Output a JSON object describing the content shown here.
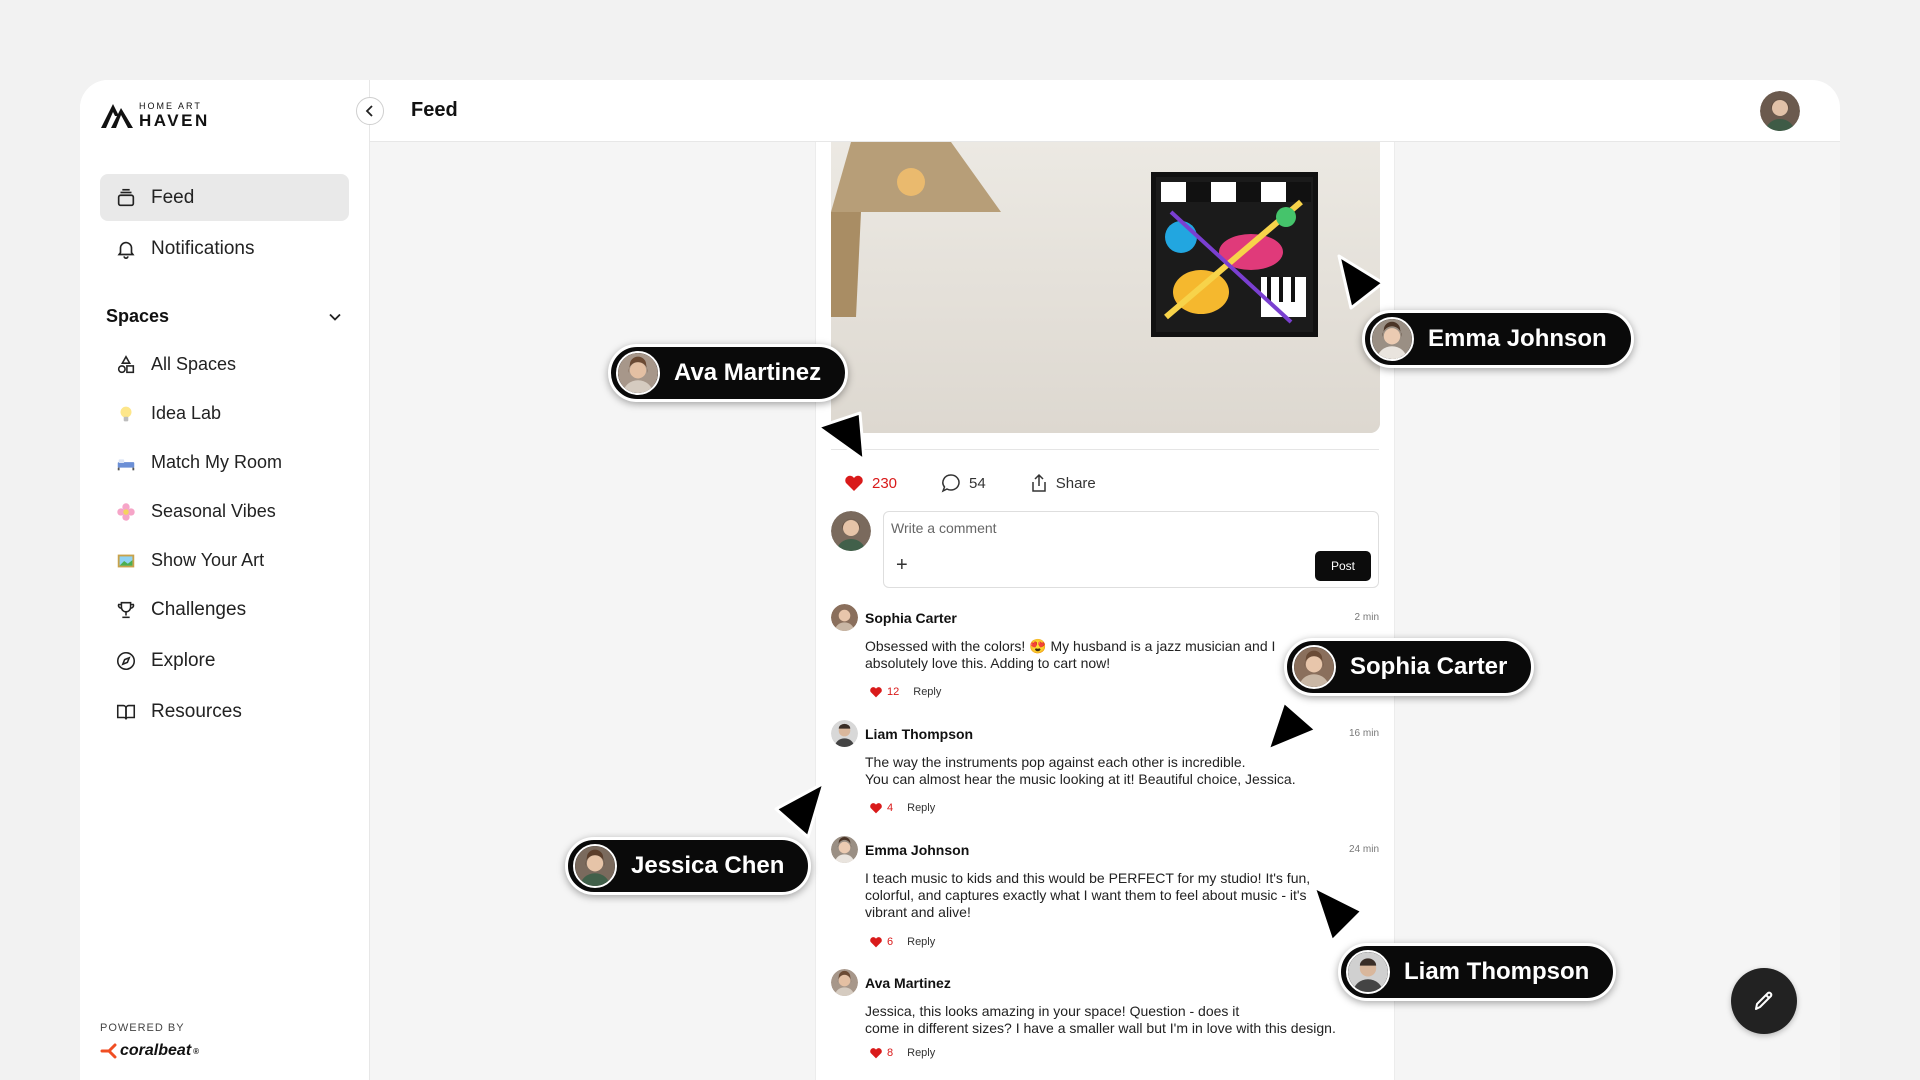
{
  "brand": {
    "small": "HOME ART",
    "big": "HAVEN"
  },
  "header": {
    "title": "Feed"
  },
  "sidebar": {
    "nav": [
      {
        "label": "Feed",
        "icon": "feed-icon"
      },
      {
        "label": "Notifications",
        "icon": "bell-icon"
      }
    ],
    "spaces_title": "Spaces",
    "spaces": [
      {
        "label": "All Spaces",
        "icon": "shapes-icon"
      },
      {
        "label": "Idea Lab",
        "icon": "lightbulb-icon"
      },
      {
        "label": "Match My Room",
        "icon": "bed-icon"
      },
      {
        "label": "Seasonal Vibes",
        "icon": "flower-icon"
      },
      {
        "label": "Show Your Art",
        "icon": "picture-icon"
      }
    ],
    "more": [
      {
        "label": "Challenges",
        "icon": "trophy-icon"
      },
      {
        "label": "Explore",
        "icon": "compass-icon"
      },
      {
        "label": "Resources",
        "icon": "book-icon"
      }
    ],
    "powered_by": "POWERED BY",
    "powered_brand": "coralbeat"
  },
  "post": {
    "likes": "230",
    "comments": "54",
    "share": "Share"
  },
  "composer": {
    "placeholder": "Write a comment",
    "post_label": "Post",
    "plus": "+"
  },
  "comments": [
    {
      "name": "Sophia Carter",
      "time": "2 min",
      "text": "Obsessed with the colors! 😍 My husband is a jazz musician and I\nabsolutely love this. Adding to cart now!",
      "likes": "12",
      "reply": "Reply"
    },
    {
      "name": "Liam Thompson",
      "time": "16 min",
      "text": "The way the instruments pop against each other is incredible.\nYou can almost hear the music looking at it! Beautiful choice, Jessica.",
      "likes": "4",
      "reply": "Reply"
    },
    {
      "name": "Emma Johnson",
      "time": "24 min",
      "text": "I teach music to kids and this would be PERFECT for my studio! It's fun,\ncolorful, and captures exactly what I want them to feel about music - it's\nvibrant and alive!",
      "likes": "6",
      "reply": "Reply"
    },
    {
      "name": "Ava Martinez",
      "time": "",
      "text": "Jessica, this looks amazing in your space! Question - does it\ncome in different sizes? I have a smaller wall but I'm in love with this design.",
      "likes": "8",
      "reply": "Reply"
    }
  ],
  "collaborators": [
    {
      "name": "Ava Martinez"
    },
    {
      "name": "Emma Johnson"
    },
    {
      "name": "Sophia Carter"
    },
    {
      "name": "Jessica Chen"
    },
    {
      "name": "Liam Thompson"
    }
  ],
  "colors": {
    "like": "#d91a1a",
    "pill": "#0a0a0a",
    "active_nav": "#e9e9e9"
  }
}
